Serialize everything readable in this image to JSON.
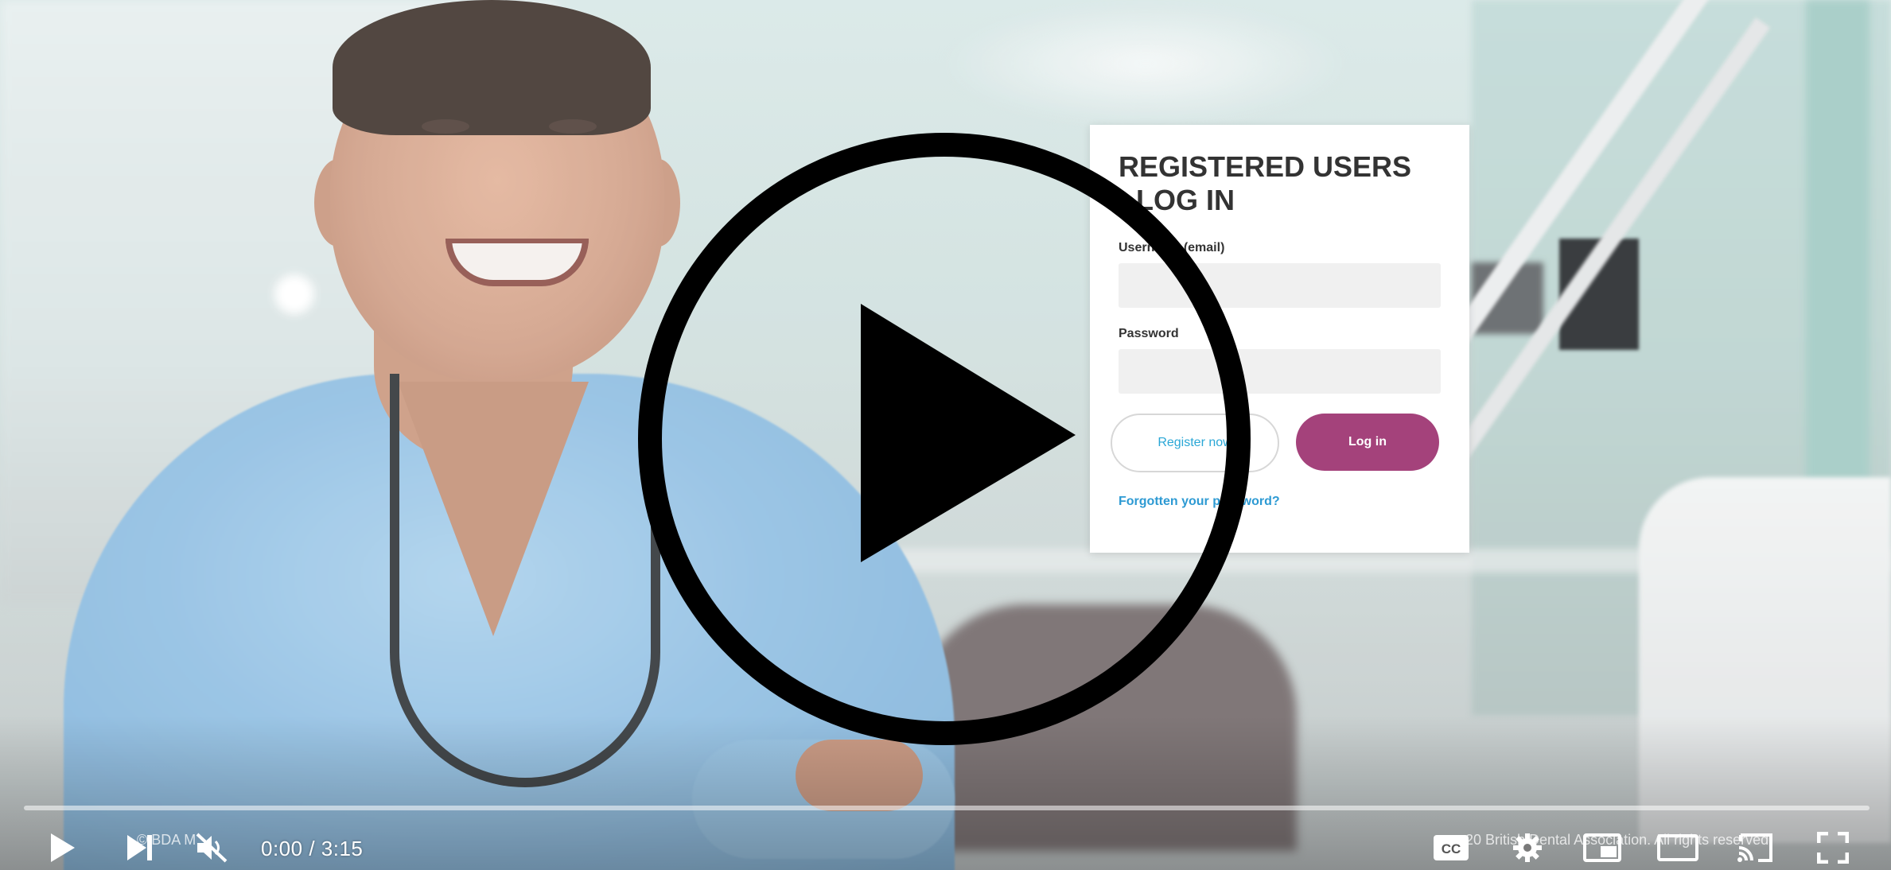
{
  "login": {
    "title": "REGISTERED USERS - LOG IN",
    "username_label": "Username (email)",
    "password_label": "Password",
    "register_label": "Register now",
    "login_label": "Log in",
    "forgot_label": "Forgotten your password?"
  },
  "player": {
    "current_time": "0:00",
    "duration": "3:15",
    "time_separator": " / ",
    "progress": 0.0,
    "footer_left": "© BDA M",
    "footer_right": "20 British Dental Association. All rights reserved."
  },
  "icons": {
    "big_play": "play-circle-icon",
    "play": "play-icon",
    "next": "next-icon",
    "mute": "volume-muted-icon",
    "captions": "captions-icon",
    "settings": "gear-icon",
    "miniplayer": "miniplayer-icon",
    "theater": "theater-mode-icon",
    "cast": "cast-icon",
    "fullscreen": "fullscreen-icon"
  },
  "colors": {
    "login_button": "#a4427b",
    "link": "#2d9ad3",
    "progress": "#ff0000"
  }
}
